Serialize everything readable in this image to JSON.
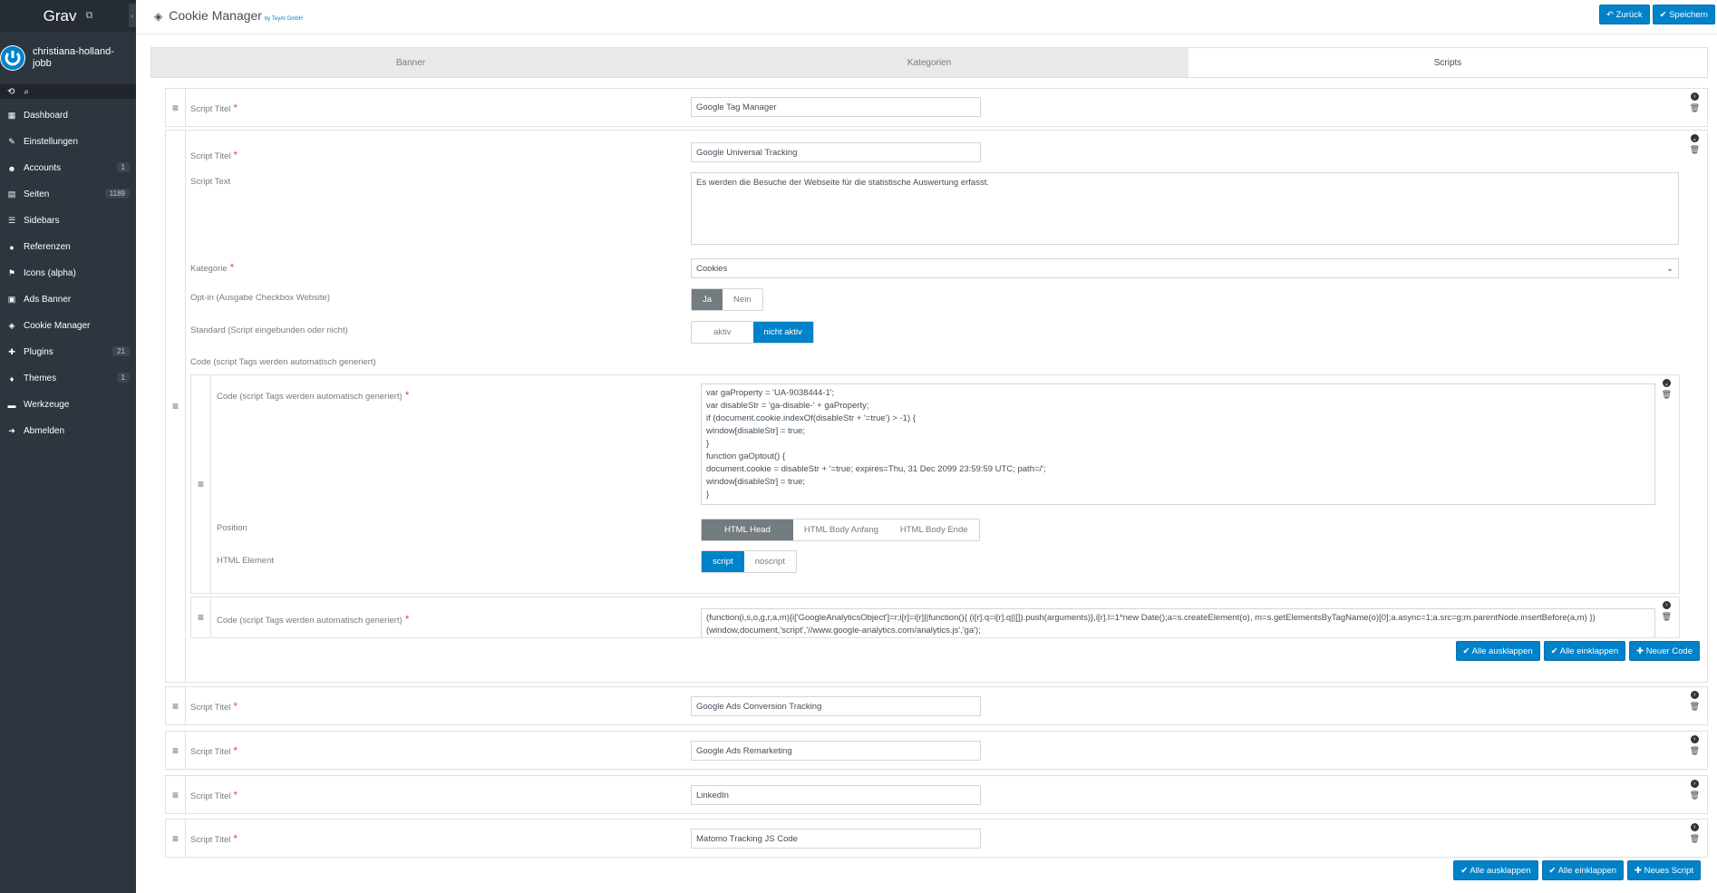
{
  "sidebar": {
    "brand": "Grav",
    "user": "christiana-holland-jobb",
    "items": [
      {
        "icon": "dashboard-icon",
        "glyph": "▦",
        "label": "Dashboard"
      },
      {
        "icon": "wrench-icon",
        "glyph": "✎",
        "label": "Einstellungen"
      },
      {
        "icon": "users-icon",
        "glyph": "☻",
        "label": "Accounts",
        "badge": "1"
      },
      {
        "icon": "file-icon",
        "glyph": "▤",
        "label": "Seiten",
        "badge": "1189"
      },
      {
        "icon": "list-icon",
        "glyph": "☰",
        "label": "Sidebars"
      },
      {
        "icon": "comment-icon",
        "glyph": "●",
        "label": "Referenzen"
      },
      {
        "icon": "flag-icon",
        "glyph": "⚑",
        "label": "Icons (alpha)"
      },
      {
        "icon": "image-icon",
        "glyph": "▣",
        "label": "Ads Banner"
      },
      {
        "icon": "shield-icon",
        "glyph": "◈",
        "label": "Cookie Manager"
      },
      {
        "icon": "plug-icon",
        "glyph": "✚",
        "label": "Plugins",
        "badge": "21"
      },
      {
        "icon": "tint-icon",
        "glyph": "♦",
        "label": "Themes",
        "badge": "1"
      },
      {
        "icon": "briefcase-icon",
        "glyph": "▬",
        "label": "Werkzeuge"
      },
      {
        "icon": "signout-icon",
        "glyph": "➜",
        "label": "Abmelden"
      }
    ]
  },
  "header": {
    "title": "Cookie Manager",
    "subtitle": "by TeyAt GmbH",
    "back_label": "↶ Zurück",
    "save_label": "✔ Speichern"
  },
  "tabs": [
    "Banner",
    "Kategorien",
    "Scripts"
  ],
  "labels": {
    "script_title": "Script Titel",
    "script_text": "Script Text",
    "category": "Kategorie",
    "optin": "Opt-in (Ausgabe Checkbox Website)",
    "standard": "Standard (Script eingebunden oder nicht)",
    "code_section": "Code (script Tags werden automatisch generiert)",
    "code": "Code (script Tags werden automatisch generiert)",
    "position": "Position",
    "html_element": "HTML Element"
  },
  "scripts": [
    {
      "title": "Google Tag Manager"
    },
    {
      "title": "Google Universal Tracking"
    },
    {
      "title": "Google Ads Conversion Tracking"
    },
    {
      "title": "Google Ads Remarketing"
    },
    {
      "title": "LinkedIn"
    },
    {
      "title": "Matomo Tracking JS Code"
    }
  ],
  "expanded": {
    "script_text": "Es werden die Besuche der Webseite für die statistische Auswertung erfasst.",
    "category": "Cookies",
    "optin": {
      "yes": "Ja",
      "no": "Nein"
    },
    "standard": {
      "on": "aktiv",
      "off": "nicht aktiv"
    },
    "code1": [
      "var gaProperty = 'UA-9038444-1';",
      "var disableStr = 'ga-disable-' + gaProperty;",
      "if (document.cookie.indexOf(disableStr + '=true') > -1) {",
      "window[disableStr] = true;",
      "}",
      "function gaOptout() {",
      "document.cookie = disableStr + '=true; expires=Thu, 31 Dec 2099 23:59:59 UTC; path=/';",
      "window[disableStr] = true;",
      "}"
    ],
    "positions": [
      "HTML Head",
      "HTML Body Anfang",
      "HTML Body Ende"
    ],
    "elements": [
      "script",
      "noscript"
    ],
    "code2": [
      "(function(i,s,o,g,r,a,m){i['GoogleAnalyticsObject']=r;i[r]=i[r]||function(){ (i[r].q=i[r].q||[]).push(arguments)},i[r].l=1*new Date();a=s.createElement(o), m=s.getElementsByTagName(o)[0];a.async=1;a.src=g;m.parentNode.insertBefore(a,m) })",
      "(window,document,'script','//www.google-analytics.com/analytics.js','ga');"
    ]
  },
  "buttons": {
    "expand_all": "✔ Alle ausklappen",
    "collapse_all": "✔ Alle einklappen",
    "new_code": "✚ Neuer Code",
    "new_script": "✚ Neues Script"
  }
}
